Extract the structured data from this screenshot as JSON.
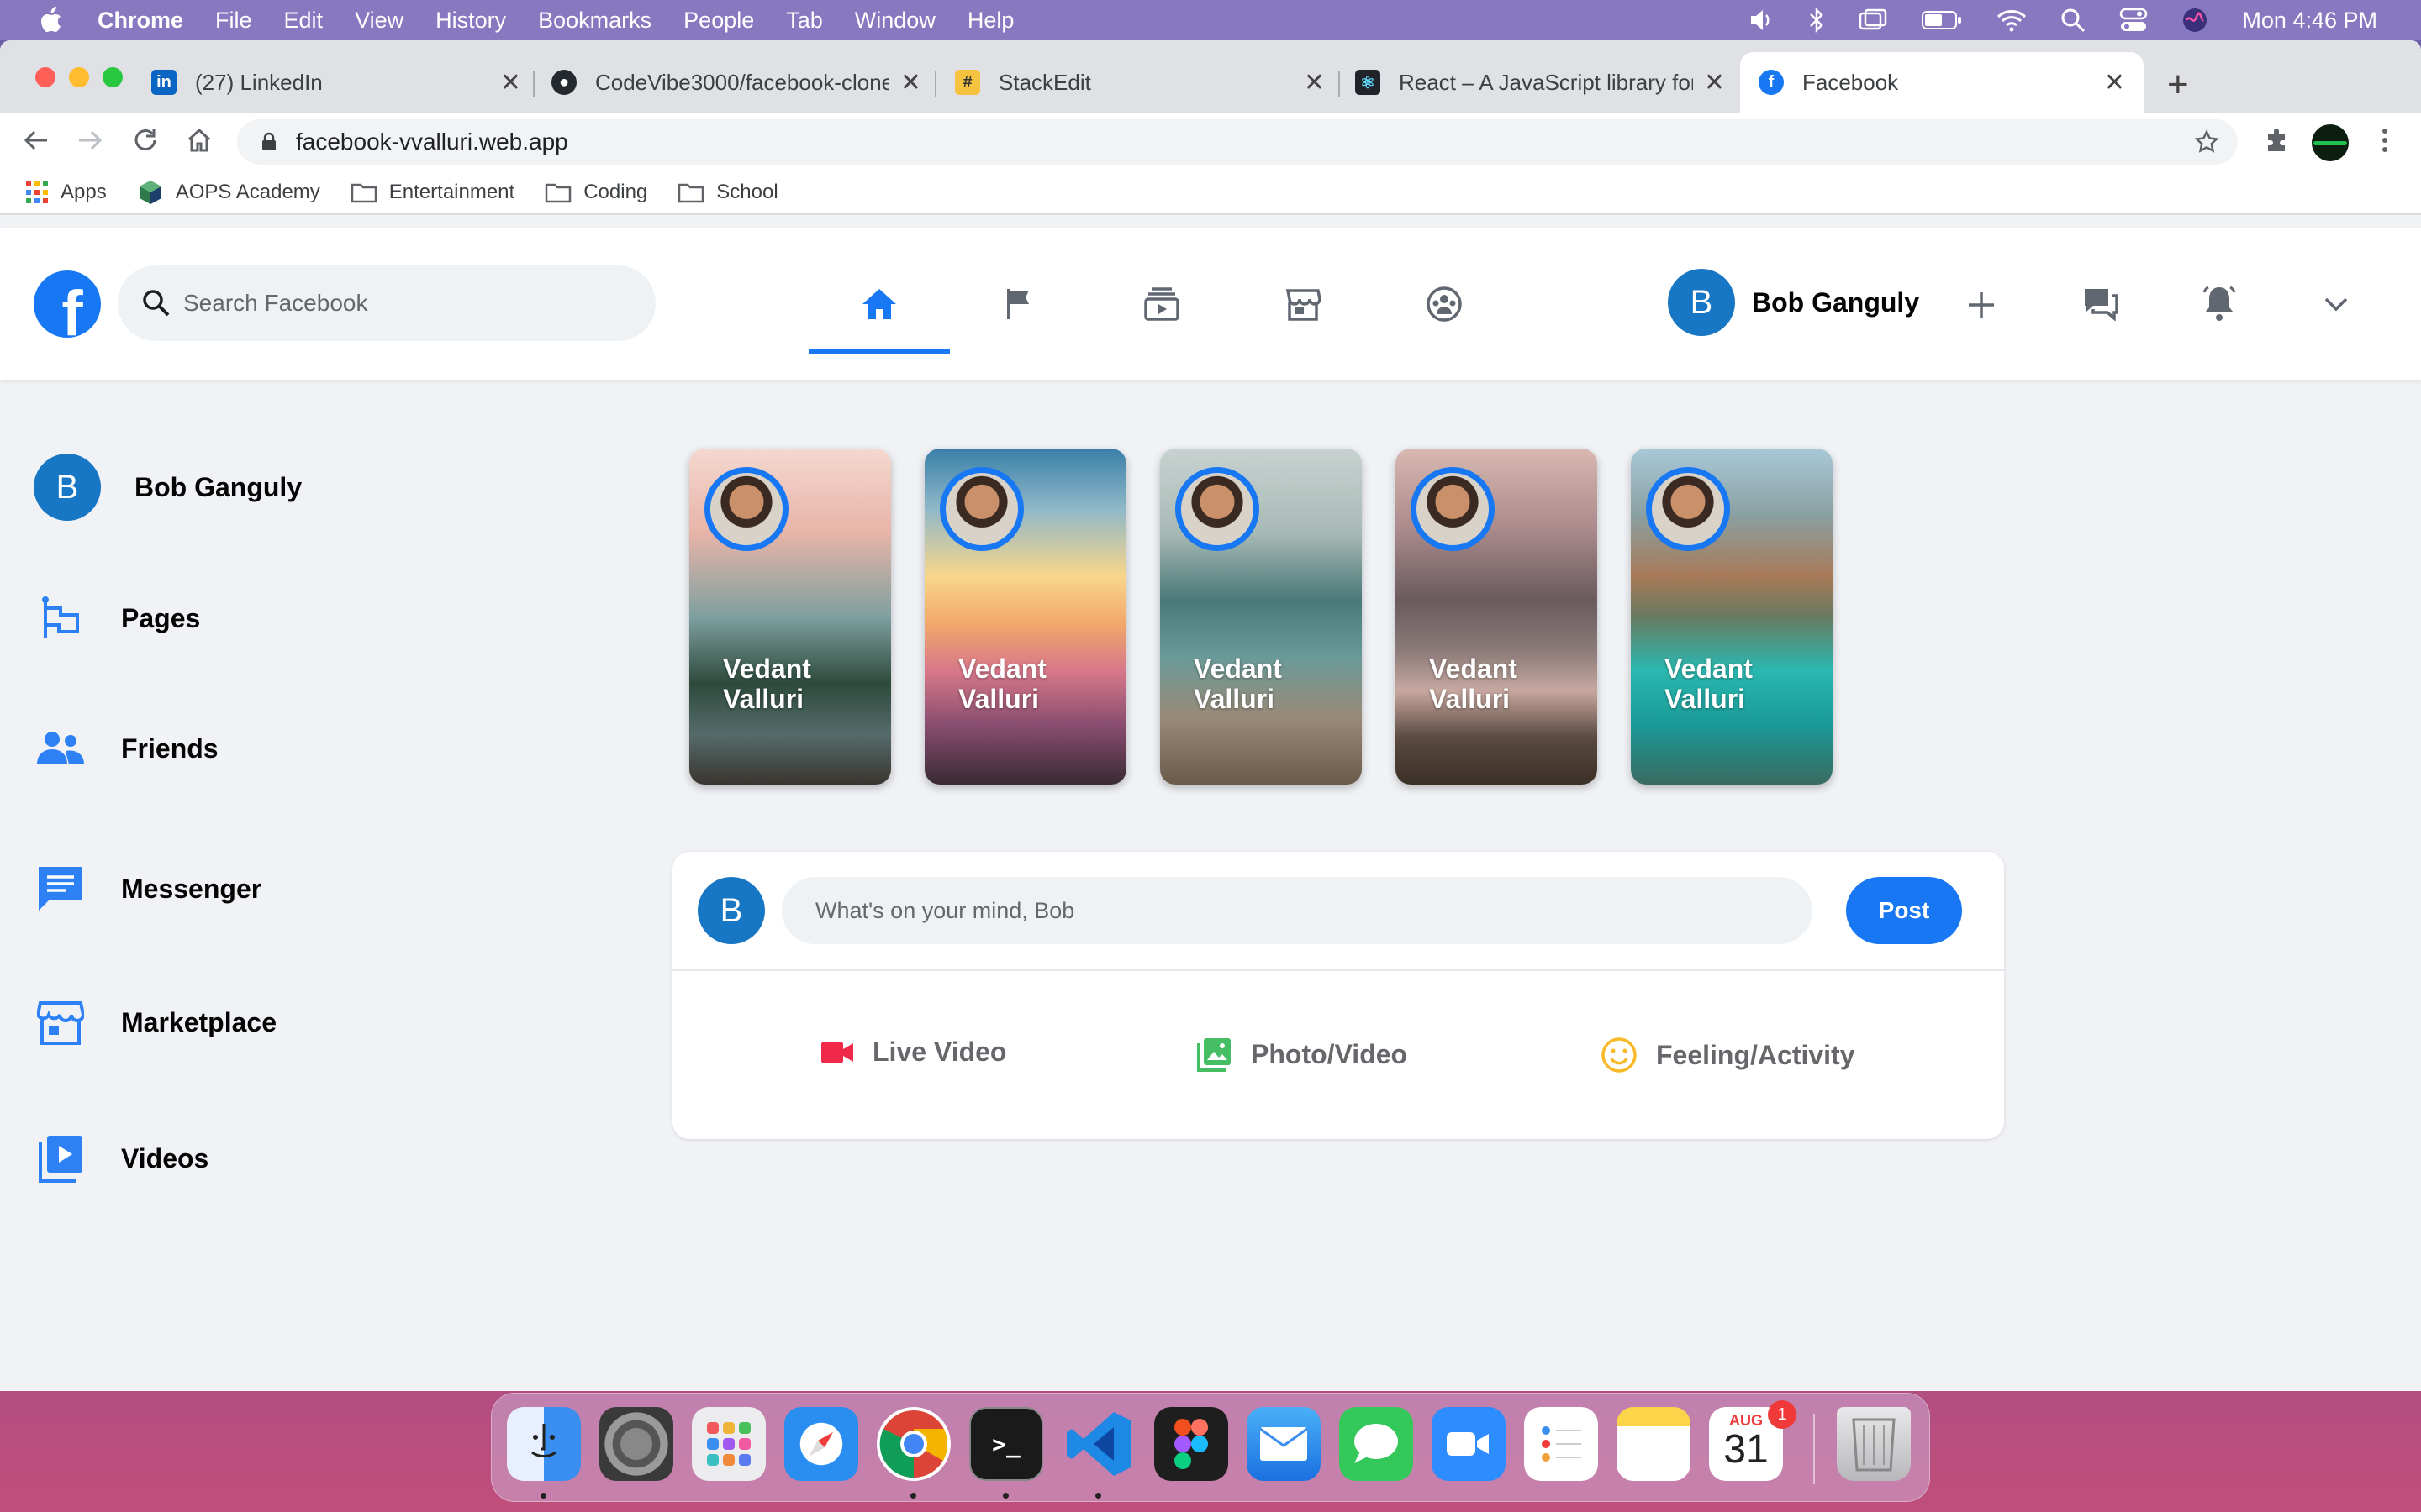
{
  "menubar": {
    "app": "Chrome",
    "items": [
      "File",
      "Edit",
      "View",
      "History",
      "Bookmarks",
      "People",
      "Tab",
      "Window",
      "Help"
    ],
    "clock": "Mon 4:46 PM"
  },
  "tabs": [
    {
      "title": "(27) LinkedIn",
      "icon": "linkedin-icon"
    },
    {
      "title": "CodeVibe3000/facebook-clone",
      "icon": "github-icon"
    },
    {
      "title": "StackEdit",
      "icon": "stackedit-icon"
    },
    {
      "title": "React – A JavaScript library for",
      "icon": "react-icon"
    },
    {
      "title": "Facebook",
      "icon": "facebook-icon",
      "active": true
    }
  ],
  "address": {
    "url": "facebook-vvalluri.web.app"
  },
  "bookmarks": [
    {
      "label": "Apps",
      "icon": "apps-grid-icon"
    },
    {
      "label": "AOPS Academy",
      "icon": "aops-icon"
    },
    {
      "label": "Entertainment",
      "icon": "folder-icon"
    },
    {
      "label": "Coding",
      "icon": "folder-icon"
    },
    {
      "label": "School",
      "icon": "folder-icon"
    }
  ],
  "header": {
    "search_placeholder": "Search Facebook",
    "nav": [
      "home-icon",
      "flag-icon",
      "watch-icon",
      "marketplace-icon",
      "groups-icon"
    ],
    "user_initial": "B",
    "user_name": "Bob Ganguly"
  },
  "sidebar": {
    "user_initial": "B",
    "user_name": "Bob Ganguly",
    "items": [
      {
        "label": "Pages",
        "icon": "pages-icon"
      },
      {
        "label": "Friends",
        "icon": "friends-icon"
      },
      {
        "label": "Messenger",
        "icon": "messenger-icon"
      },
      {
        "label": "Marketplace",
        "icon": "marketplace-icon"
      },
      {
        "label": "Videos",
        "icon": "videos-icon"
      }
    ]
  },
  "stories": [
    {
      "name": "Vedant Valluri"
    },
    {
      "name": "Vedant Valluri"
    },
    {
      "name": "Vedant Valluri"
    },
    {
      "name": "Vedant Valluri"
    },
    {
      "name": "Vedant Valluri"
    }
  ],
  "composer": {
    "initial": "B",
    "placeholder": "What's on your mind, Bob",
    "post_label": "Post",
    "actions": [
      {
        "label": "Live Video",
        "icon": "video-camera-icon",
        "color": "#f02849"
      },
      {
        "label": "Photo/Video",
        "icon": "photo-icon",
        "color": "#45bd62"
      },
      {
        "label": "Feeling/Activity",
        "icon": "smiley-icon",
        "color": "#f7b928"
      }
    ]
  },
  "dock": {
    "calendar_month": "AUG",
    "calendar_day": "31",
    "calendar_badge": "1"
  },
  "colors": {
    "brand": "#1877f2",
    "background": "#f0f2f5"
  }
}
